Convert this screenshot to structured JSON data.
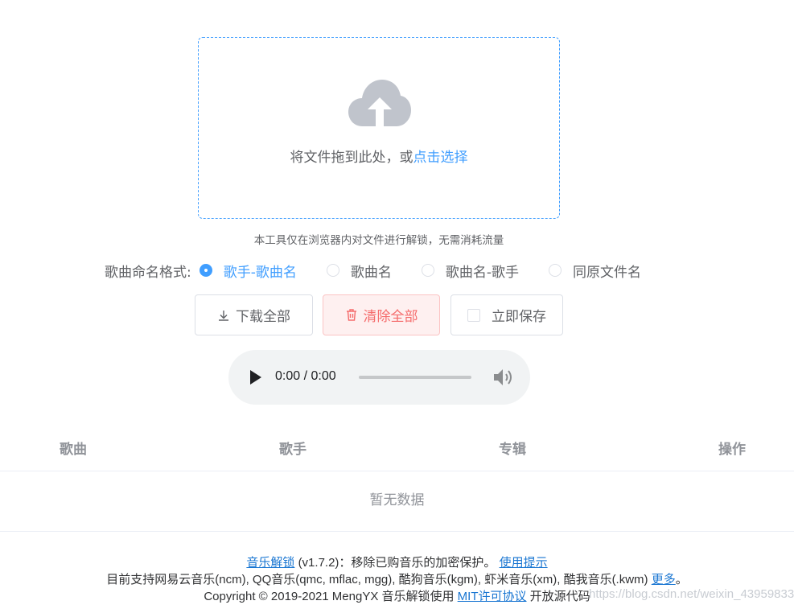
{
  "upload": {
    "prompt": "将文件拖到此处，或",
    "link": "点击选择",
    "tip": "本工具仅在浏览器内对文件进行解锁，无需消耗流量",
    "icon": "cloud-upload-icon"
  },
  "naming": {
    "label": "歌曲命名格式:",
    "options": [
      "歌手-歌曲名",
      "歌曲名",
      "歌曲名-歌手",
      "同原文件名"
    ],
    "selected": "歌手-歌曲名"
  },
  "buttons": {
    "download": "下载全部",
    "clear": "清除全部",
    "save": "立即保存"
  },
  "player": {
    "time": "0:00 / 0:00"
  },
  "table": {
    "columns": [
      "歌曲",
      "歌手",
      "专辑",
      "操作"
    ],
    "empty_text": "暂无数据"
  },
  "footer": {
    "app_link": "音乐解锁",
    "version_text": "(v1.7.2)：移除已购音乐的加密保护。",
    "help_link": "使用提示",
    "support_text": "目前支持网易云音乐(ncm), QQ音乐(qmc, mflac, mgg), 酷狗音乐(kgm), 虾米音乐(xm), 酷我音乐(.kwm)",
    "more_link": "更多",
    "period": "。",
    "copyright_text": "Copyright © 2019-2021 MengYX 音乐解锁使用",
    "license_link": "MIT许可协议",
    "open_source_text": "开放源代码"
  },
  "watermark": "https://blog.csdn.net/weixin_43959833",
  "colors": {
    "primary": "#409eff",
    "danger": "#f56c6c",
    "danger_bg": "#fef0f0",
    "link": "#1976d2"
  }
}
